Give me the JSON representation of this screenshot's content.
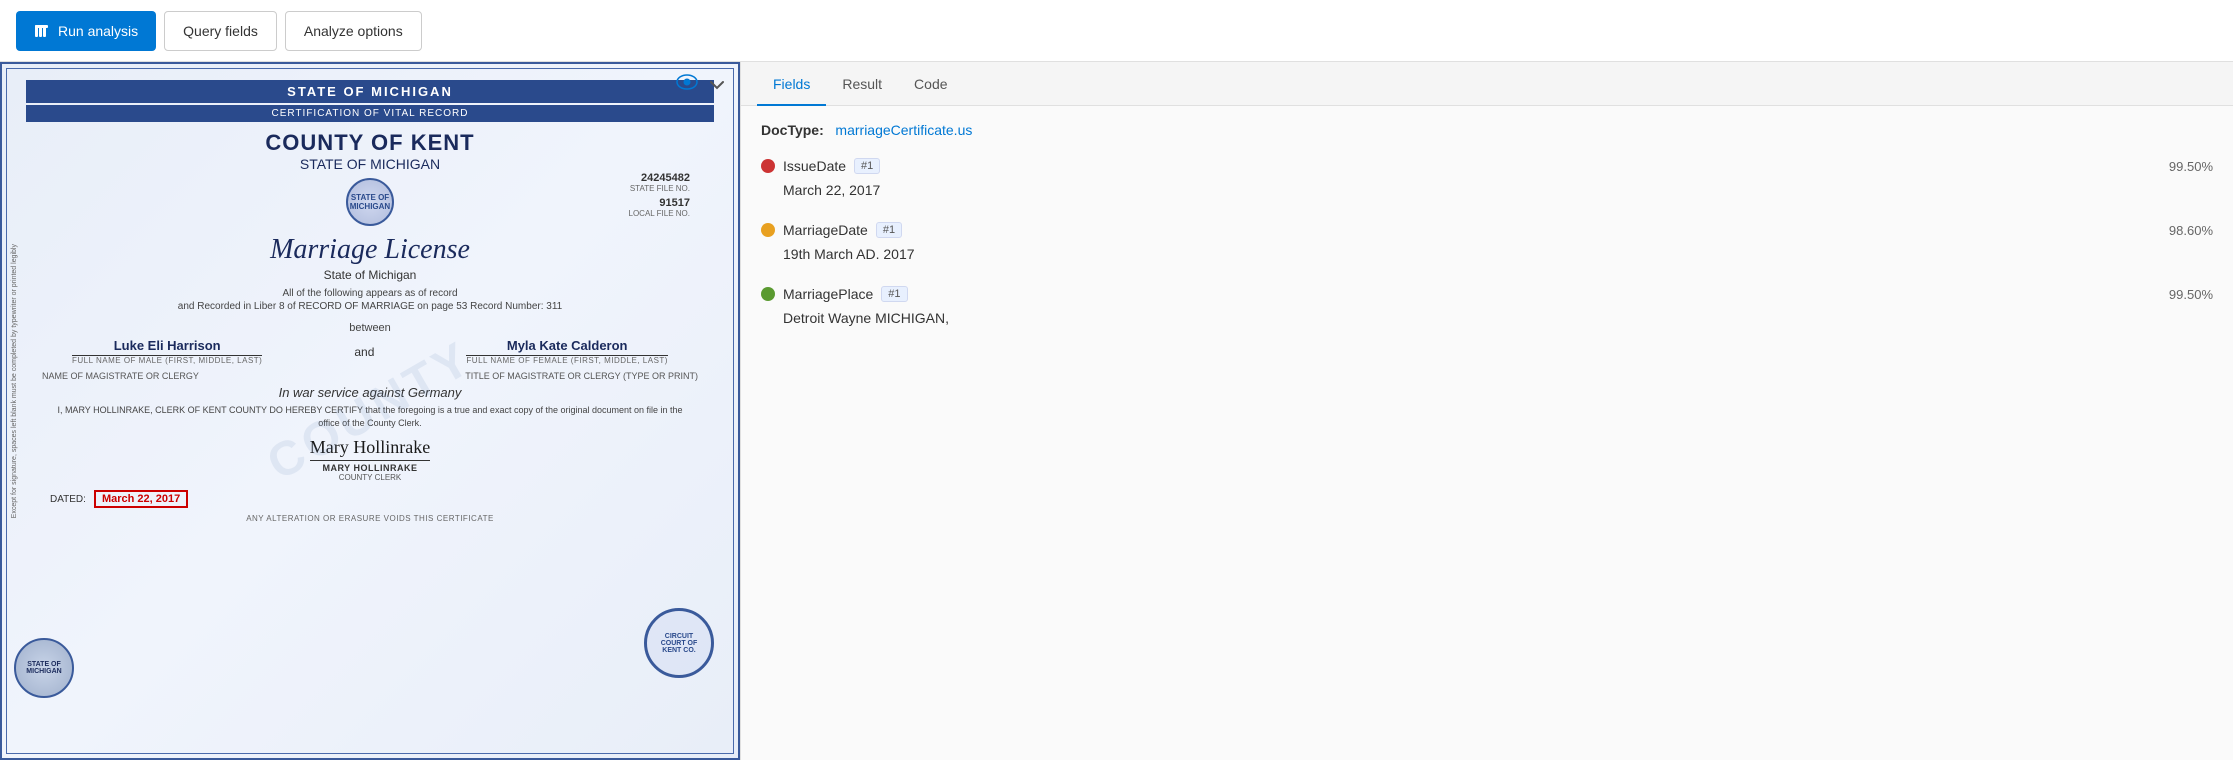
{
  "toolbar": {
    "run_button_label": "Run analysis",
    "query_fields_label": "Query fields",
    "analyze_options_label": "Analyze options"
  },
  "document": {
    "header_banner": "STATE OF MICHIGAN",
    "sub_banner": "CERTIFICATION OF VITAL RECORD",
    "county": "COUNTY OF KENT",
    "state": "STATE OF MICHIGAN",
    "file_no_label": "STATE FILE NO.",
    "file_no_value": "24245482",
    "local_file_label": "LOCAL FILE NO.",
    "local_file_value": "91517",
    "title": "Marriage License",
    "subtitle": "State of Michigan",
    "body_text": "All of the following appears as of record",
    "record_line": "and Recorded in Liber  8  of RECORD OF MARRIAGE on page  53  Record Number:  311",
    "between_label": "between",
    "groom_name": "Luke Eli Harrison",
    "groom_label": "FULL NAME OF MALE (FIRST, MIDDLE, LAST)",
    "and_label": "and",
    "bride_name": "Myla Kate Calderon",
    "bride_label": "FULL NAME OF FEMALE (FIRST, MIDDLE, LAST)",
    "war_service_text": "In war service against Germany",
    "certification_text": "I, MARY HOLLINRAKE, CLERK OF KENT COUNTY DO HEREBY CERTIFY that the foregoing is a true and exact copy of the original document on file in the office of the County Clerk.",
    "magistrate_label": "NAME OF MAGISTRATE OR CLERGY",
    "title_label": "TITLE OF MAGISTRATE OR CLERGY (TYPE OR PRINT)",
    "sig_name": "MARY HOLLINRAKE",
    "sig_title": "COUNTY CLERK",
    "dated_label": "DATED:",
    "dated_value": "March 22, 2017",
    "footer_text": "ANY ALTERATION OR ERASURE VOIDS THIS CERTIFICATE",
    "watermark": "COUNTY",
    "left_text": "Except for signature, spaces left blank must be completed by typewriter or printed legibly",
    "stamp_text": "CIRCUIT COURT OF KENT CO.",
    "seal_text": "STATE OF MICHIGAN"
  },
  "right_panel": {
    "tabs": [
      {
        "id": "fields",
        "label": "Fields",
        "active": true
      },
      {
        "id": "result",
        "label": "Result",
        "active": false
      },
      {
        "id": "code",
        "label": "Code",
        "active": false
      }
    ],
    "doctype_label": "DocType:",
    "doctype_value": "marriageCertificate.us",
    "fields": [
      {
        "name": "IssueDate",
        "badge": "#1",
        "dot_color": "#cc3333",
        "confidence": "99.50%",
        "value": "March 22, 2017"
      },
      {
        "name": "MarriageDate",
        "badge": "#1",
        "dot_color": "#e8a020",
        "confidence": "98.60%",
        "value": "19th March AD. 2017"
      },
      {
        "name": "MarriagePlace",
        "badge": "#1",
        "dot_color": "#5a9a30",
        "confidence": "99.50%",
        "value": "Detroit Wayne MICHIGAN,"
      }
    ]
  }
}
